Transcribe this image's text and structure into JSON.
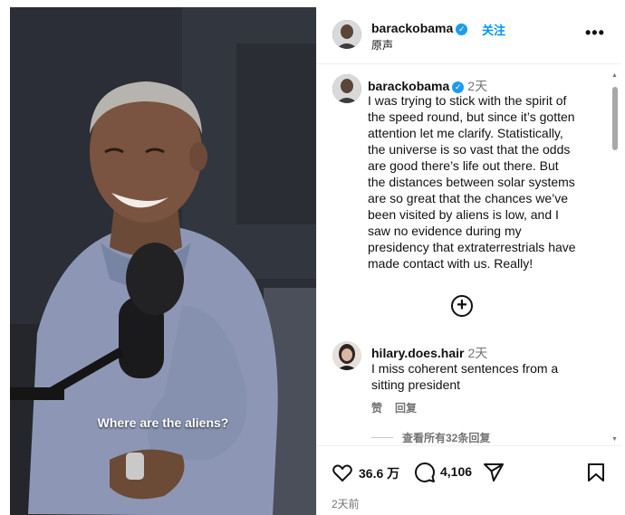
{
  "video": {
    "caption": "Where are the aliens?"
  },
  "header": {
    "username": "barackobama",
    "verified_mark": "✓",
    "separator": "•",
    "follow_label": "关注",
    "audio_label": "原声",
    "more_label": "•••"
  },
  "post": {
    "username": "barackobama",
    "verified_mark": "✓",
    "time": "2天",
    "lines": [
      "I was trying to stick with the spirit of",
      "the speed round, but since it’s gotten",
      "attention let me clarify. Statistically,",
      "the universe is so vast that the odds",
      "are good there’s life out there. But",
      "the distances between solar systems",
      "are so great that the chances we’ve",
      "been visited by aliens is low, and I",
      "saw no evidence during my",
      "presidency that extraterrestrials have",
      "made contact with us. Really!"
    ]
  },
  "load_more": {
    "icon": "plus-circle-icon",
    "label": "+"
  },
  "comment": {
    "username": "hilary.does.hair",
    "time": "2天",
    "lines": [
      "I miss coherent sentences from a",
      "sitting president"
    ],
    "like_label": "赞",
    "reply_label": "回复",
    "view_replies_label": "查看所有32条回复"
  },
  "actions": {
    "like_count": "36.6 万",
    "comment_count": "4,106",
    "date": "2天前"
  },
  "colors": {
    "link_blue": "#0095f6",
    "verified_blue": "#1d9bf0",
    "secondary_text": "#737373"
  }
}
